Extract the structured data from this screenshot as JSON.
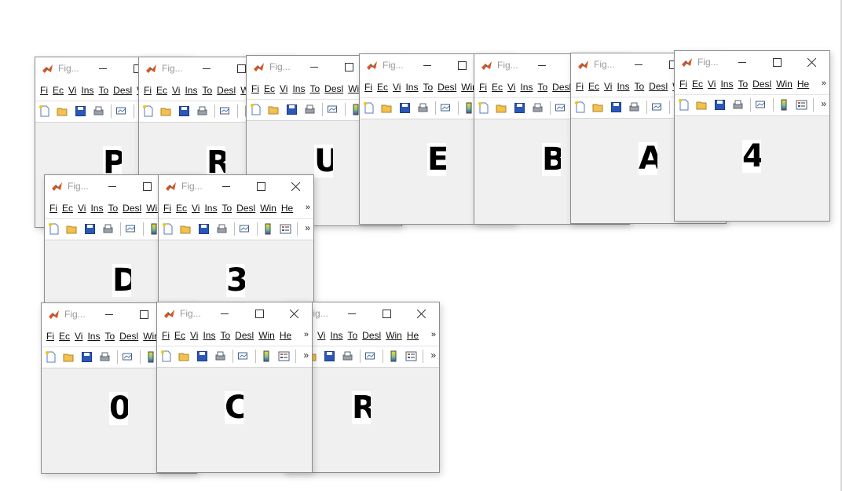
{
  "windows": [
    {
      "title": "Fig...",
      "letter": "P"
    },
    {
      "title": "Fig...",
      "letter": "R"
    },
    {
      "title": "Fig...",
      "letter": "U"
    },
    {
      "title": "Fig...",
      "letter": "E"
    },
    {
      "title": "Fig...",
      "letter": "B"
    },
    {
      "title": "Fig...",
      "letter": "A"
    },
    {
      "title": "Fig...",
      "letter": "4"
    },
    {
      "title": "Fig...",
      "letter": "D"
    },
    {
      "title": "Fig...",
      "letter": "3"
    },
    {
      "title": "Fig...",
      "letter": "0"
    },
    {
      "title": "Fig...",
      "letter": "R"
    },
    {
      "title": "Fig...",
      "letter": "C"
    }
  ],
  "menu": [
    "Fi",
    "Ec",
    "Vi",
    "Ins",
    "To",
    "Desl",
    "Win",
    "He"
  ],
  "menu_more": "»",
  "toolbar_more": "»",
  "colors": {
    "matlab_icon": "#d9541e",
    "window_bg": "#f0f0f0",
    "glyph_bg": "#ffffff",
    "glyph_fg": "#000000"
  },
  "icons": [
    "matlab-logo-icon",
    "new-figure-icon",
    "open-file-icon",
    "save-icon",
    "print-icon",
    "link-plot-icon",
    "colorbar-icon",
    "legend-icon"
  ]
}
